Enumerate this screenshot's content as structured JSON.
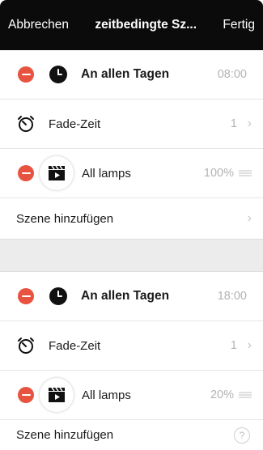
{
  "navbar": {
    "cancel": "Abbrechen",
    "title": "zeitbedingte Sz...",
    "done": "Fertig"
  },
  "colors": {
    "accent_red": "#e8533f",
    "navbar_bg": "#0b0b0b",
    "secondary_text": "#b3b3b3"
  },
  "blocks": [
    {
      "schedule_label": "An allen Tagen",
      "time": "08:00",
      "fade_label": "Fade-Zeit",
      "fade_value": "1",
      "lamp_label": "All lamps",
      "lamp_value": "100%",
      "add_scene": "Szene hinzufügen"
    },
    {
      "schedule_label": "An allen Tagen",
      "time": "18:00",
      "fade_label": "Fade-Zeit",
      "fade_value": "1",
      "lamp_label": "All lamps",
      "lamp_value": "20%",
      "add_scene": "Szene hinzufügen"
    }
  ],
  "icons": {
    "remove": "minus-circle-icon",
    "clock": "clock-icon",
    "timer": "timer-icon",
    "scene": "clapperboard-icon",
    "chevron": "chevron-right-icon",
    "reorder": "reorder-grip-icon",
    "help": "help-icon"
  }
}
